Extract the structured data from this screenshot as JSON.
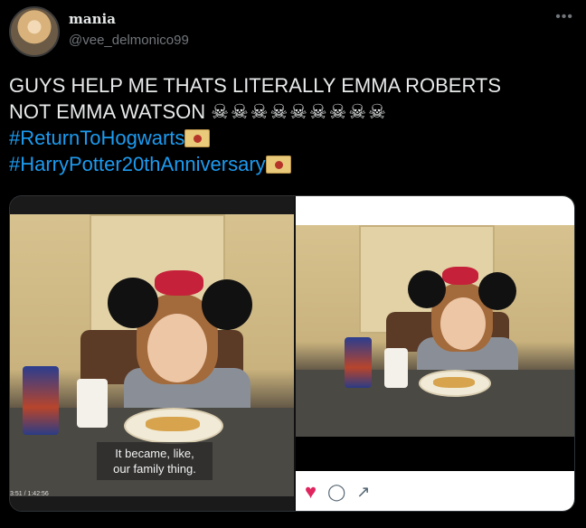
{
  "user": {
    "display_name": "mania",
    "handle": "@vee_delmonico99"
  },
  "tweet": {
    "line1": "GUYS HELP ME THATS LITERALLY EMMA ROBERTS",
    "line2": "NOT EMMA WATSON",
    "skulls": "☠☠☠☠☠☠☠☠☠",
    "hashtag1": "#ReturnToHogwarts",
    "hashtag2": "#HarryPotter20thAnniversary"
  },
  "media": {
    "subtitle_line1": "It became, like,",
    "subtitle_line2": "our family thing.",
    "timecode": "3:51 / 1:42:56"
  },
  "icons": [
    "more-icon",
    "heart-icon",
    "comment-icon",
    "share-icon",
    "envelope-emoji",
    "skull-emoji"
  ],
  "colors": {
    "hashtag": "#1d9bf0",
    "heart": "#e0245e",
    "background": "#000000"
  }
}
